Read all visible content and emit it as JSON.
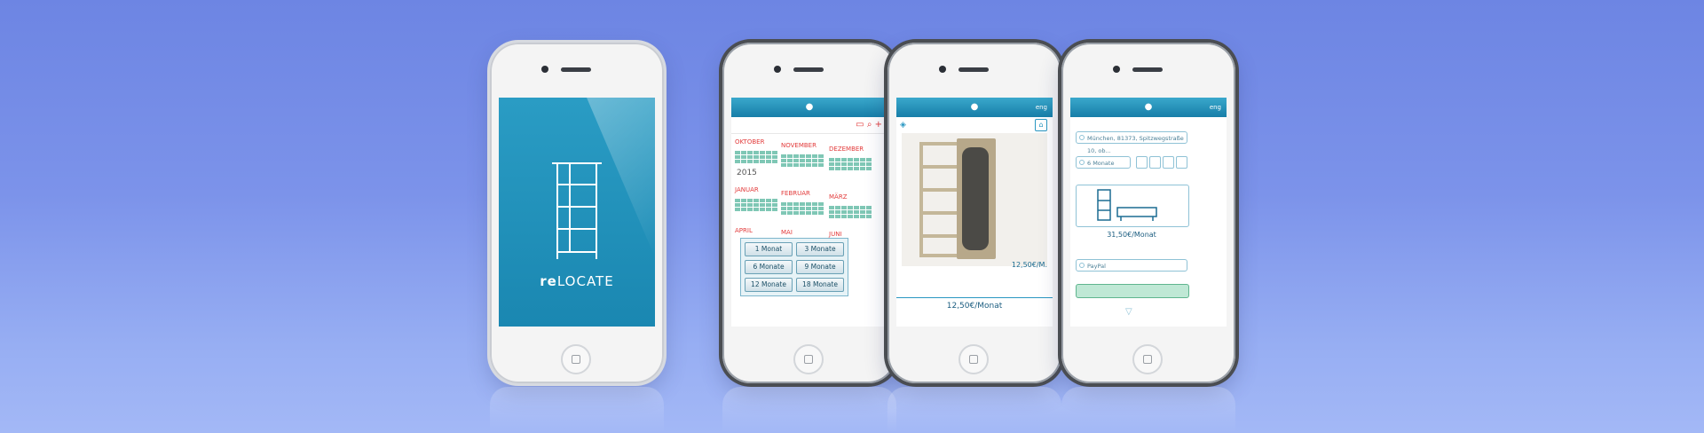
{
  "splash": {
    "brand_bold": "re",
    "brand_rest": "LOCATE"
  },
  "calendar": {
    "icons": [
      "cart-icon",
      "search-icon",
      "plus-icon"
    ],
    "months_top": [
      "OKTOBER",
      "NOVEMBER",
      "DEZEMBER"
    ],
    "year": "2015",
    "months_mid": [
      "JANUAR",
      "FEBRUAR",
      "MÄRZ"
    ],
    "months_bottom": [
      "APRIL",
      "MAI",
      "JUNI"
    ],
    "durations": [
      "1 Monat",
      "3 Monate",
      "6 Monate",
      "9 Monate",
      "12 Monate",
      "18 Monate"
    ]
  },
  "product": {
    "lang": "eng",
    "price_badge": "12,50€/M.",
    "price": "12,50€/Monat"
  },
  "form": {
    "lang": "eng",
    "address": "München, 81373, Spitzwegstraße 10, ob...",
    "duration": "6 Monate",
    "total": "31,50€/Monat",
    "payment": "PayPal"
  },
  "colors": {
    "accent": "#1a87b1",
    "calendar_red": "#e23b3b",
    "available": "#7fc7b5"
  }
}
